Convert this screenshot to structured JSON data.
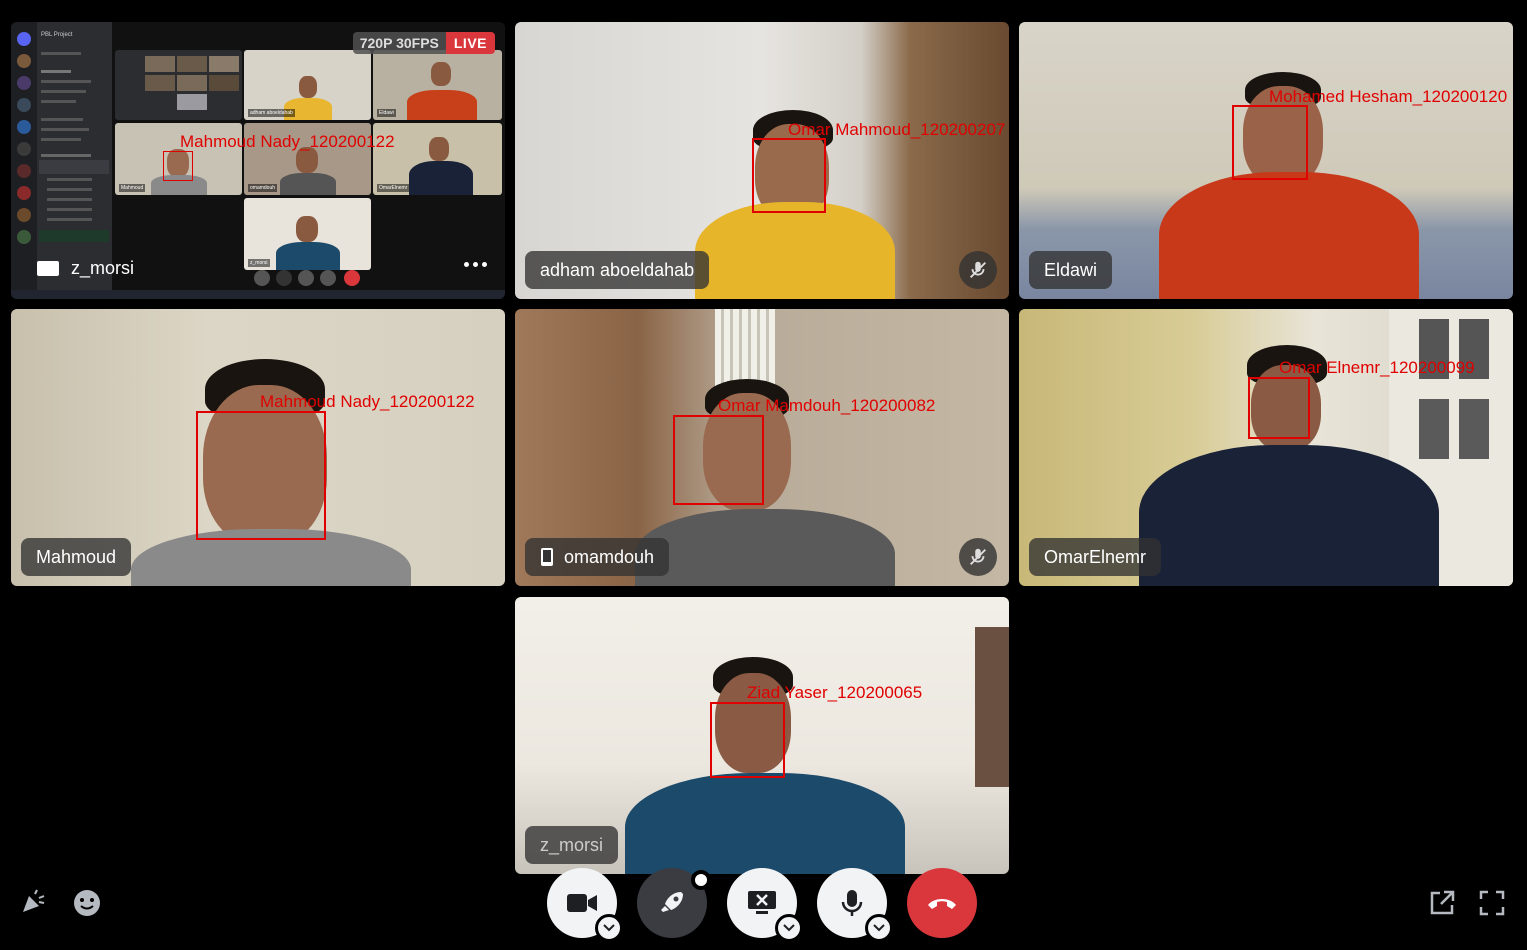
{
  "screen_share": {
    "name": "z_morsi",
    "resolution_badge": "720P 30FPS",
    "live_badge": "LIVE",
    "inner_server_name": "PBL Project",
    "inner_face_label": "Mahmoud Nady_120200122",
    "inner_names": [
      "adham aboeldahab",
      "Eldawi",
      "Mahmoud",
      "omamdouh",
      "OmarElnemr",
      "z_morsi"
    ]
  },
  "tiles": [
    {
      "name": "adham aboeldahab",
      "face_label": "Omar Mahmoud_120200207",
      "muted": true,
      "mobile": false
    },
    {
      "name": "Eldawi",
      "face_label": "Mohamed Hesham_120200120",
      "muted": false,
      "mobile": false
    },
    {
      "name": "Mahmoud",
      "face_label": "Mahmoud Nady_120200122",
      "muted": false,
      "mobile": false
    },
    {
      "name": "omamdouh",
      "face_label": "Omar Mamdouh_120200082",
      "muted": true,
      "mobile": true
    },
    {
      "name": "OmarElnemr",
      "face_label": "Omar Elnemr_120200099",
      "muted": false,
      "mobile": false
    },
    {
      "name": "z_morsi",
      "face_label": "Ziad Yaser_120200065",
      "muted": false,
      "mobile": false
    }
  ],
  "colors": {
    "background": "#000000",
    "face_box": "#e00000",
    "leave_button": "#da373c",
    "control_light": "#f2f3f5",
    "control_dark": "#3a3c42"
  },
  "controls": {
    "left": [
      "soundboard-icon",
      "emoji-icon"
    ],
    "center": [
      "camera-icon",
      "activity-rocket-icon",
      "stop-screen-share-icon",
      "microphone-icon",
      "hang-up-icon"
    ],
    "right": [
      "pop-out-icon",
      "fullscreen-icon"
    ]
  }
}
